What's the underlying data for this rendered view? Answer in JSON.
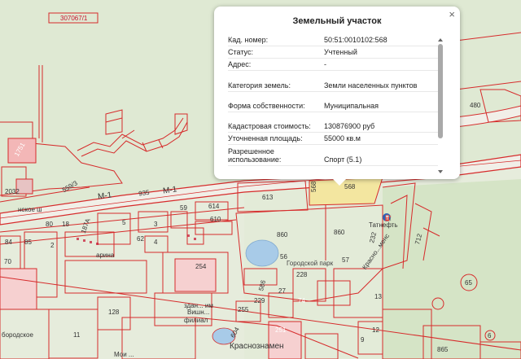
{
  "popup": {
    "title": "Земельный участок",
    "close_glyph": "×",
    "rows": [
      {
        "key": "Кад. номер:",
        "value": "50:51:0010102:568"
      },
      {
        "key": "Статус:",
        "value": "Учтенный"
      },
      {
        "key": "Адрес:",
        "value": "-"
      },
      {
        "key": "Категория земель:",
        "value": "Земли населенных пунктов"
      },
      {
        "key": "Форма собственности:",
        "value": "Муниципальная"
      },
      {
        "key": "Кадастровая стоимость:",
        "value": "130876900 руб"
      },
      {
        "key": "Уточненная площадь:",
        "value": "55000 кв.м"
      },
      {
        "key": "Разрешенное использование:",
        "value": "Спорт (5.1)"
      }
    ]
  },
  "map": {
    "parcel_labels": {
      "top_left": "307067/1",
      "p1751": "1751",
      "p2032": "2032",
      "p559": "559/3",
      "p935": "935",
      "p613": "613",
      "p568a": "568",
      "p568b": "568",
      "p480": "480",
      "p614": "614",
      "p610": "610",
      "p59": "59",
      "p860a": "860",
      "p860b": "860",
      "p232": "232",
      "p712": "712",
      "p65": "65",
      "p5": "5",
      "p3": "3",
      "p4": "4",
      "p62": "62",
      "p254": "254",
      "p56": "56",
      "p57": "57",
      "p228": "228",
      "p586": "586",
      "p27": "27",
      "p229": "229",
      "p255": "255",
      "p604": "604",
      "p251": "251",
      "p74": "74",
      "p13": "13",
      "p12": "12",
      "p9": "9",
      "p11": "11",
      "p128": "128",
      "p84": "84",
      "p85": "85",
      "p80": "80",
      "p18": "18",
      "p2": "2",
      "p187": "187А",
      "p70": "70",
      "p865": "865",
      "p6": "6"
    },
    "road_m1_a": "М-1",
    "road_m1_b": "М-1",
    "street_left": "нское ш",
    "street_bottom_left": "Мои   ...",
    "park_label": "Городской парк",
    "tatneft": "Татнефть",
    "krasnoz": "Краснознамен",
    "krasn_top": "Красно...менс",
    "fil": "филиал",
    "vish": "Вишн...",
    "zd": "здан... им",
    "bor": "бородское",
    "arina": "арина"
  },
  "colors": {
    "background": "#e6ecdc",
    "forest": "#d4e4c4",
    "parcel_line": "#d62b2b",
    "highlight": "#f3e6a0",
    "water": "#a8cbe8",
    "road": "#f2f2ee"
  }
}
